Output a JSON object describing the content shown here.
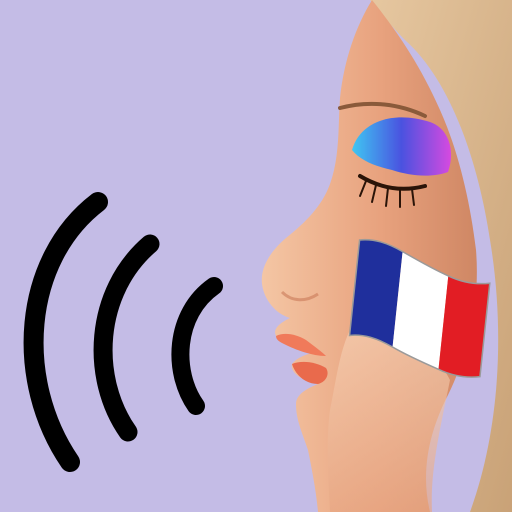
{
  "app_icon": {
    "background_color": "#c4bce6",
    "sound_wave_color": "#000000",
    "sound_wave_count": 3,
    "icons": [
      "sound-waves-icon",
      "face-profile-icon",
      "french-flag-icon"
    ],
    "flag_colors": {
      "blue": "#1f2f9c",
      "white": "#ffffff",
      "red": "#e21d24"
    },
    "skin_colors": {
      "light": "#f4c6a4",
      "mid": "#e8a27e",
      "shadow": "#cf8764"
    },
    "hair_color": "#c9a277",
    "eyeshadow_colors": [
      "#4a52e0",
      "#3fc7f2",
      "#d64ae0"
    ],
    "lip_color": "#f07a5a"
  }
}
